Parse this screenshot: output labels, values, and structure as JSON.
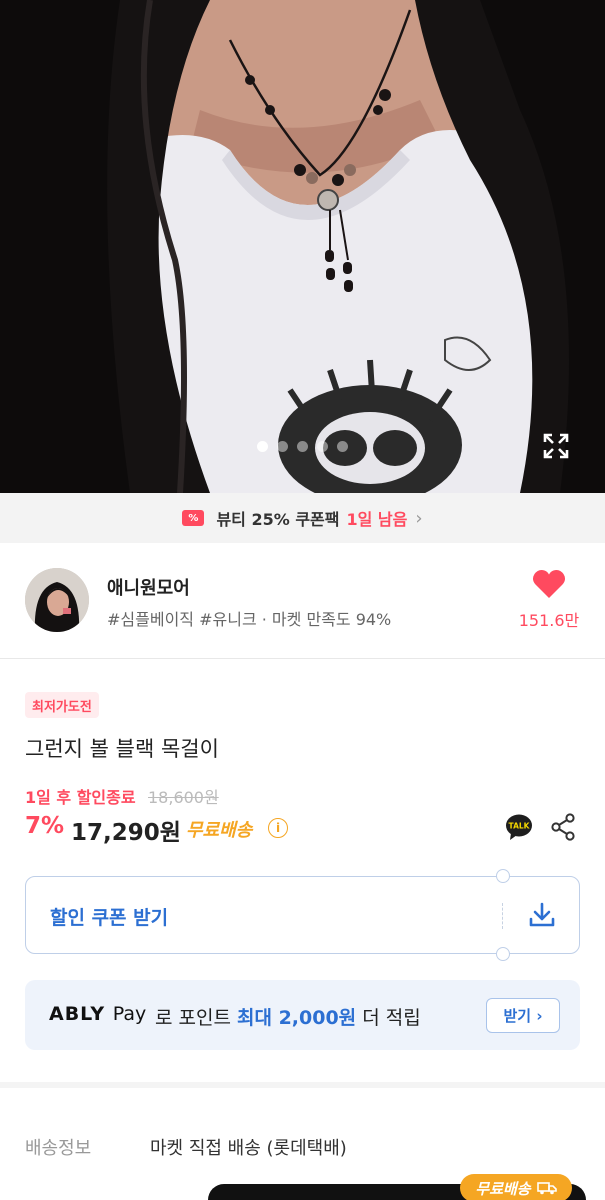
{
  "hero": {
    "dots_total": 5,
    "dots_active_index": 0,
    "expand_icon": "expand-icon"
  },
  "coupon_strip": {
    "icon": "coupon-ticket-icon",
    "text": "뷰티 25% 쿠폰팩",
    "days_left": "1일 남음"
  },
  "seller": {
    "name": "애니원모어",
    "tags": "#심플베이직 #유니크 · 마켓 만족도 94%",
    "like_count": "151.6만",
    "like_color": "#ff4a5f"
  },
  "product": {
    "badge": "최저가도전",
    "name": "그런지 볼 블랙 목걸이",
    "sale_end": "1일 후 할인종료",
    "original_price": "18,600원",
    "discount": "7%",
    "price": "17,290원",
    "free_shipping": "무료배송"
  },
  "coupon_download": {
    "label": "할인 쿠폰 받기"
  },
  "ably_pay": {
    "logo": "ABLY",
    "logo_suffix": "Pay",
    "text_pre": "로 포인트 ",
    "highlight": "최대 2,000원",
    "text_post": " 더 적립",
    "button": "받기"
  },
  "shipping": {
    "label": "배송정보",
    "value": "마켓 직접 배송 (롯데택배)"
  },
  "floating": {
    "free_badge": "무료배송"
  },
  "colors": {
    "accent": "#ff4a5f",
    "blue": "#2c6fd2",
    "orange": "#f5a623"
  }
}
